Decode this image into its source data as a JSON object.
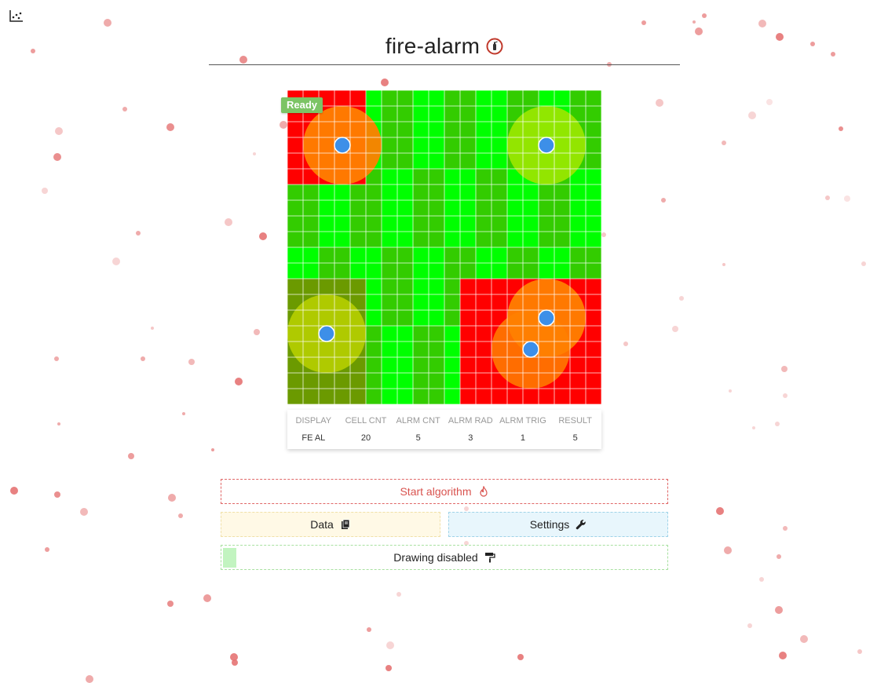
{
  "app": {
    "title": "fire-alarm",
    "title_icon": "fire-extinguisher-icon",
    "top_left_icon": "scatter-plot-icon"
  },
  "grid": {
    "status_badge": "Ready",
    "cell_count": 20,
    "colors": {
      "red": "#ff0000",
      "green_a": "#00ff00",
      "green_b": "#33cc00",
      "olive": "#669900",
      "orange": "#ff8000",
      "lime": "#99e600",
      "yellow_green": "#b3cc00",
      "yellow": "#ffcc00",
      "alarm_dot": "#3d8fe8"
    },
    "regions": [
      {
        "c0": 0,
        "r0": 0,
        "c1": 5,
        "r1": 6,
        "fill": "#ff0000"
      },
      {
        "c0": 0,
        "r0": 12,
        "c1": 5,
        "r1": 20,
        "fill": "#6b9a00"
      },
      {
        "c0": 11,
        "r0": 12,
        "c1": 20,
        "r1": 20,
        "fill": "#ff0000"
      }
    ],
    "alarms": [
      {
        "col": 3.5,
        "row": 3.5,
        "color": "#ff8000",
        "opacity": 0.95
      },
      {
        "col": 16.5,
        "row": 3.5,
        "color": "#99e600",
        "opacity": 0.95
      },
      {
        "col": 2.5,
        "row": 15.5,
        "color": "#b3cc00",
        "opacity": 0.95
      },
      {
        "col": 16.5,
        "row": 14.5,
        "color": "#ff8000",
        "opacity": 0.95
      },
      {
        "col": 15.5,
        "row": 16.5,
        "color": "#ff8000",
        "opacity": 0.85
      }
    ]
  },
  "stats": {
    "headers": [
      "DISPLAY",
      "CELL CNT",
      "ALRM CNT",
      "ALRM RAD",
      "ALRM TRIG",
      "RESULT"
    ],
    "values": [
      "FE AL",
      "20",
      "5",
      "3",
      "1",
      "5"
    ]
  },
  "buttons": {
    "start_label": "Start algorithm",
    "start_icon": "fire-icon",
    "data_label": "Data",
    "data_icon": "clipboard-icon",
    "settings_label": "Settings",
    "settings_icon": "wrench-icon",
    "draw_label": "Drawing disabled",
    "draw_icon": "paint-roller-icon",
    "draw_progress": 0.03
  }
}
